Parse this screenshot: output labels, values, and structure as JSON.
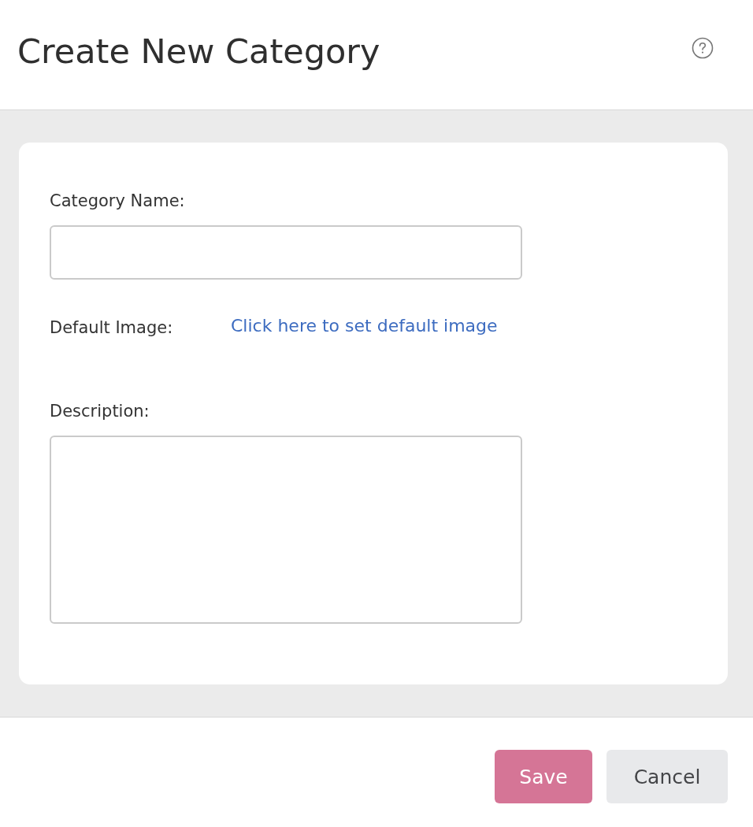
{
  "dialog": {
    "title": "Create New Category"
  },
  "form": {
    "fields": [
      {
        "kind": "text",
        "label": "Category Name:"
      },
      {
        "kind": "image",
        "label": "Default Image:",
        "link": "Click here to set default image"
      },
      {
        "kind": "textarea",
        "label": "Description:"
      }
    ]
  },
  "buttons": [
    {
      "label": "Save",
      "kind": "primary"
    },
    {
      "label": "Cancel",
      "kind": "secondary"
    }
  ]
}
